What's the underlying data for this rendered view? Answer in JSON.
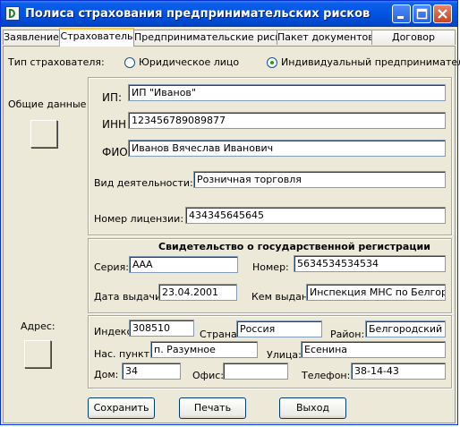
{
  "window": {
    "title": "Полиса страхования предпринимательских рисков"
  },
  "tabs": [
    {
      "label": "Заявление",
      "active": false
    },
    {
      "label": "Страхователь",
      "active": true
    },
    {
      "label": "Предпринимательские риски",
      "active": false
    },
    {
      "label": "Пакет документов",
      "active": false
    },
    {
      "label": "Договор",
      "active": false
    }
  ],
  "insurer_type": {
    "label": "Тип страхователя:",
    "options": [
      {
        "label": "Юридическое лицо",
        "selected": false
      },
      {
        "label": "Индивидуальный предприниматель",
        "selected": true
      }
    ]
  },
  "general": {
    "label": "Общие данные",
    "ip_label": "ИП:",
    "ip_value": "ИП \"Иванов\"",
    "inn_label": "ИНН",
    "inn_value": "123456789089877",
    "fio_label": "ФИО:",
    "fio_value": "Иванов Вячеслав Иванович",
    "activity_label": "Вид деятельности:",
    "activity_value": "Розничная торговля",
    "license_label": "Номер лицензии:",
    "license_value": "434345645645"
  },
  "registration": {
    "heading": "Свидетельство о государственной регистрации",
    "series_label": "Серия:",
    "series_value": "ААА",
    "number_label": "Номер:",
    "number_value": "5634534534534",
    "date_label": "Дата выдачи:",
    "date_value": "23.04.2001",
    "issuer_label": "Кем выдан:",
    "issuer_value": "Инспекция МНС по Белгоро"
  },
  "address": {
    "label": "Адрес:",
    "index_label": "Индекс:",
    "index_value": "308510",
    "country_label": "Страна:",
    "country_value": "Россия",
    "region_label": "Район:",
    "region_value": "Белгородский",
    "locality_label": "Нас. пункт:",
    "locality_value": "п. Разумное",
    "street_label": "Улица:",
    "street_value": "Есенина",
    "house_label": "Дом:",
    "house_value": "34",
    "office_label": "Офис:",
    "office_value": "",
    "phone_label": "Телефон:",
    "phone_value": "38-14-43"
  },
  "buttons": {
    "save": "Сохранить",
    "print": "Печать",
    "exit": "Выход"
  },
  "colors": {
    "titlebar": "#0054e3",
    "window_bg": "#ece9d8",
    "active_tab_accent": "#ffc83c",
    "close_button": "#c8431f"
  }
}
